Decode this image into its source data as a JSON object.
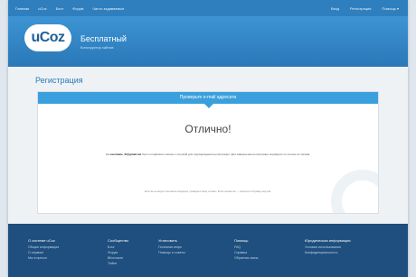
{
  "topbar": {
    "left": [
      "Главная",
      "uCoz",
      "Блог",
      "Форум",
      "Часто задаваемые"
    ],
    "right": [
      "Вход",
      "Регистрация",
      "Помощь ▾"
    ]
  },
  "header": {
    "logo": "uCoz",
    "tagline": "Бесплатный",
    "sub": "Конструктор сайтов"
  },
  "page": {
    "title": "Регистрация"
  },
  "card": {
    "header": "Проверьте e-mail адресата",
    "success": "Отлично!",
    "message_prefix": "На ",
    "email": "username_2t@gmail.net",
    "message_rest": " было отправлено письмо с ссылкой для подтверждения регистрации. Для завершения регистрации перейдите по ссылке из письма.",
    "note": "Если вы не видите письма во входящих, проверьте папку «Спам». Если письма нет — запросите отправку ещё раз."
  },
  "footer": {
    "columns": [
      {
        "heading": "О системе uCoz",
        "items": [
          "Общая информация",
          "О сервисе",
          "Мы в прессе"
        ]
      },
      {
        "heading": "Сообщество",
        "items": [
          "Блог",
          "Форум",
          "ВКонтакте",
          "Twitter"
        ]
      },
      {
        "heading": "Установить",
        "items": [
          "Полезная инфо",
          "Помощь и советы"
        ]
      },
      {
        "heading": "Помощь",
        "items": [
          "FAQ",
          "Справка",
          "Обратная связь"
        ]
      },
      {
        "heading": "Юридическая информация",
        "items": [
          "Условия использования",
          "Конфиденциальность"
        ]
      }
    ]
  }
}
